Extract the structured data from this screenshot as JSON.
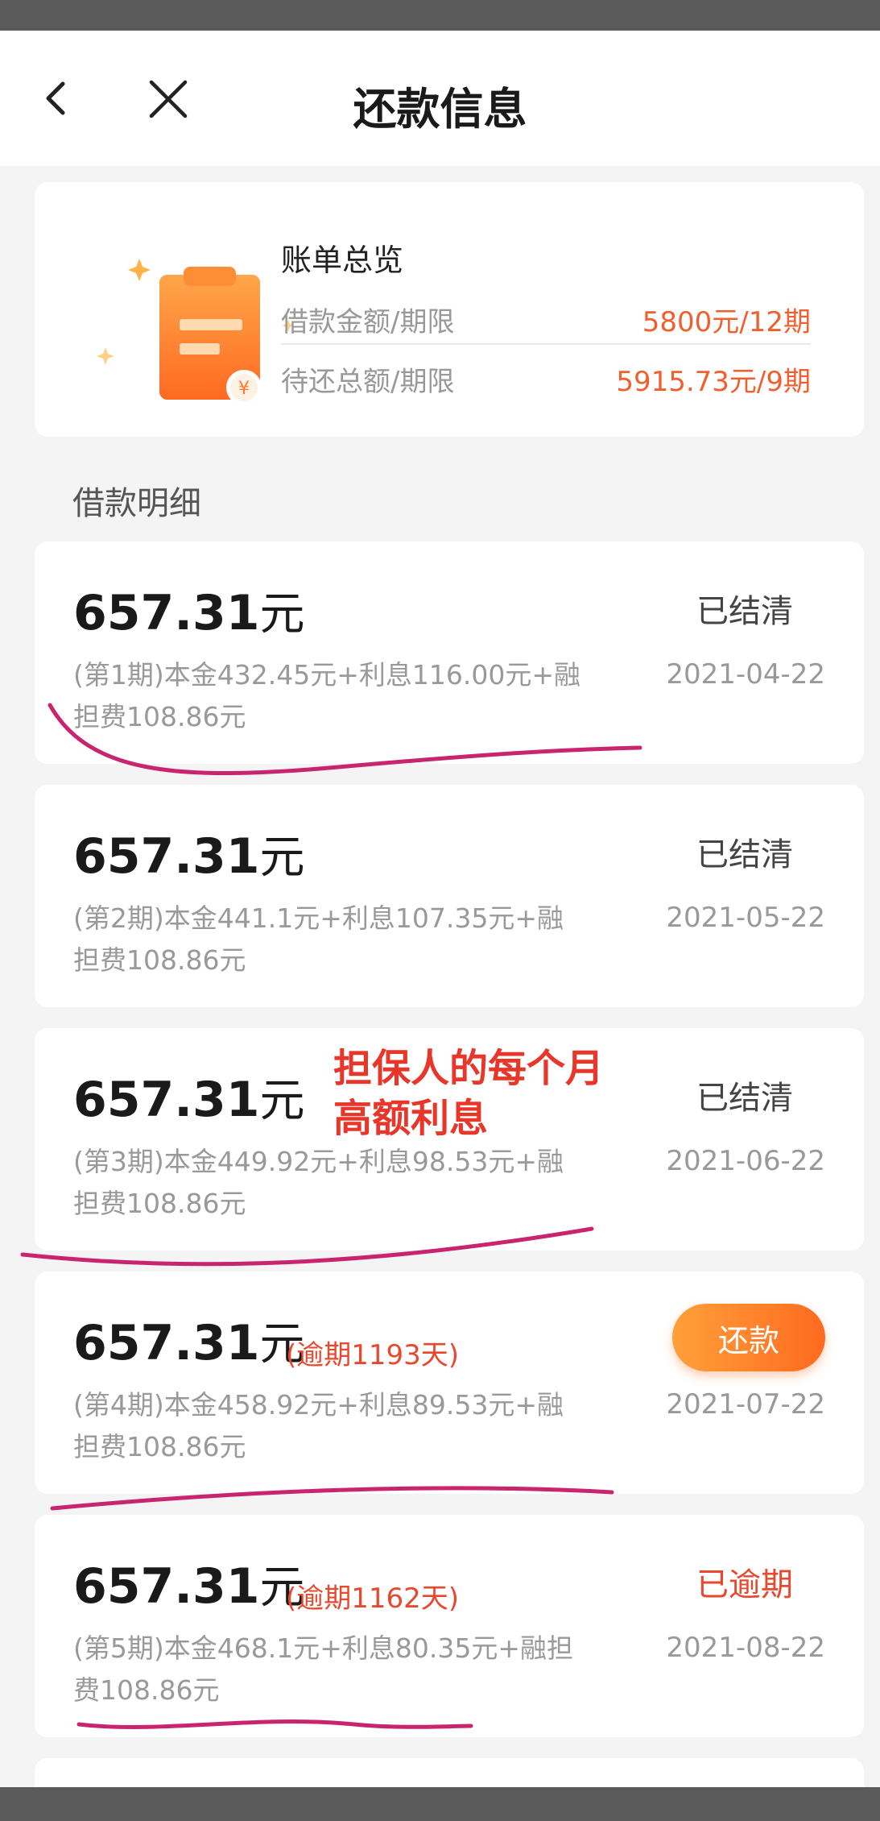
{
  "header": {
    "title": "还款信息"
  },
  "summary": {
    "title": "账单总览",
    "rows": [
      {
        "label": "借款金额/期限",
        "value": "5800元/12期"
      },
      {
        "label": "待还总额/期限",
        "value": "5915.73元/9期"
      }
    ]
  },
  "section_label": "借款明细",
  "installments": [
    {
      "amount": "657.31",
      "unit": "元",
      "overdue": "",
      "status": "已结清",
      "desc": "(第1期)本金432.45元+利息116.00元+融担费108.86元",
      "date": "2021-04-22"
    },
    {
      "amount": "657.31",
      "unit": "元",
      "overdue": "",
      "status": "已结清",
      "desc": "(第2期)本金441.1元+利息107.35元+融担费108.86元",
      "date": "2021-05-22"
    },
    {
      "amount": "657.31",
      "unit": "元",
      "overdue": "",
      "status": "已结清",
      "desc": "(第3期)本金449.92元+利息98.53元+融担费108.86元",
      "date": "2021-06-22"
    },
    {
      "amount": "657.31",
      "unit": "元",
      "overdue": "(逾期1193天)",
      "button": "还款",
      "desc": "(第4期)本金458.92元+利息89.53元+融担费108.86元",
      "date": "2021-07-22"
    },
    {
      "amount": "657.31",
      "unit": "元",
      "overdue": "(逾期1162天)",
      "status": "已逾期",
      "desc": "(第5期)本金468.1元+利息80.35元+融担费108.86元",
      "date": "2021-08-22"
    }
  ],
  "annotation": {
    "line1": "担保人的每个月",
    "line2": "高额利息"
  },
  "colors": {
    "accent": "#f0602e",
    "overdue_red": "#e8482e",
    "annotation_magenta": "#c8256e"
  }
}
